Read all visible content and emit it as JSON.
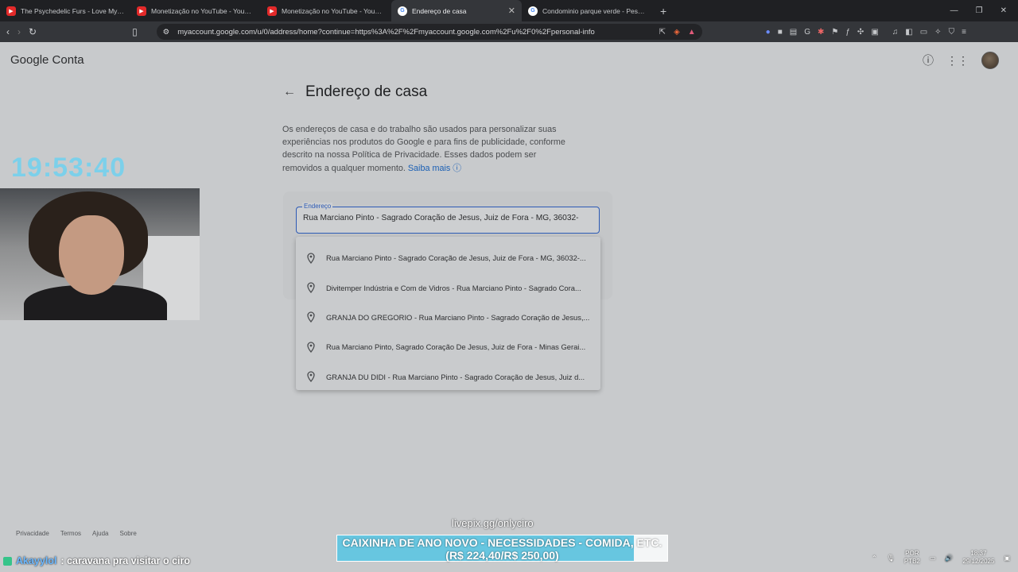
{
  "browser": {
    "tabs": [
      {
        "label": "The Psychedelic Furs - Love My Way",
        "icon": "youtube-icon"
      },
      {
        "label": "Monetização no YouTube - YouTube",
        "icon": "youtube-icon"
      },
      {
        "label": "Monetização no YouTube - YouTube",
        "icon": "youtube-icon"
      },
      {
        "label": "Endereço de casa",
        "icon": "google-icon",
        "active": true
      },
      {
        "label": "Condominio parque verde - Pesquisa",
        "icon": "google-icon"
      }
    ],
    "url": "myaccount.google.com/u/0/address/home?continue=https%3A%2F%2Fmyaccount.google.com%2Fu%2F0%2Fpersonal-info"
  },
  "header": {
    "logo_google": "Google",
    "logo_conta": "Conta"
  },
  "main": {
    "title": "Endereço de casa",
    "description": "Os endereços de casa e do trabalho são usados para personalizar suas experiências nos produtos do Google e para fins de publicidade, conforme descrito na nossa Política de Privacidade. Esses dados podem ser removidos a qualquer momento.",
    "learn_more": "Saiba mais",
    "address_label": "Endereço",
    "address_value": "Rua Marciano Pinto - Sagrado Coração de Jesus, Juiz de Fora - MG, 36032-",
    "suggestions": [
      "Rua Marciano Pinto - Sagrado Coração de Jesus, Juiz de Fora - MG, 36032-...",
      "Divitemper Indústria e Com de Vidros - Rua Marciano Pinto - Sagrado Cora...",
      "GRANJA DO GREGORIO - Rua Marciano Pinto - Sagrado Coração de Jesus,...",
      "Rua Marciano Pinto, Sagrado Coração De Jesus, Juiz de Fora - Minas Gerai...",
      "GRANJA DU DIDI - Rua Marciano Pinto - Sagrado Coração de Jesus, Juiz d..."
    ]
  },
  "footer": {
    "privacy": "Privacidade",
    "terms": "Termos",
    "help": "Ajuda",
    "about": "Sobre"
  },
  "overlay": {
    "clock": "19:53:40",
    "livepix": "livepix.gg/onlyciro",
    "donation_line1": "CAIXINHA DE ANO NOVO - NECESSIDADES - COMIDA, ETC.",
    "donation_line2": "(R$ 224,40/R$ 250,00)",
    "donation_progress": 0.8976,
    "chat_user": "Akayylol",
    "chat_message": ": caravana pra visitar o ciro"
  },
  "taskbar": {
    "lang": "POR",
    "layout": "PTB2",
    "time": "18:37",
    "date": "29/12/2025"
  }
}
